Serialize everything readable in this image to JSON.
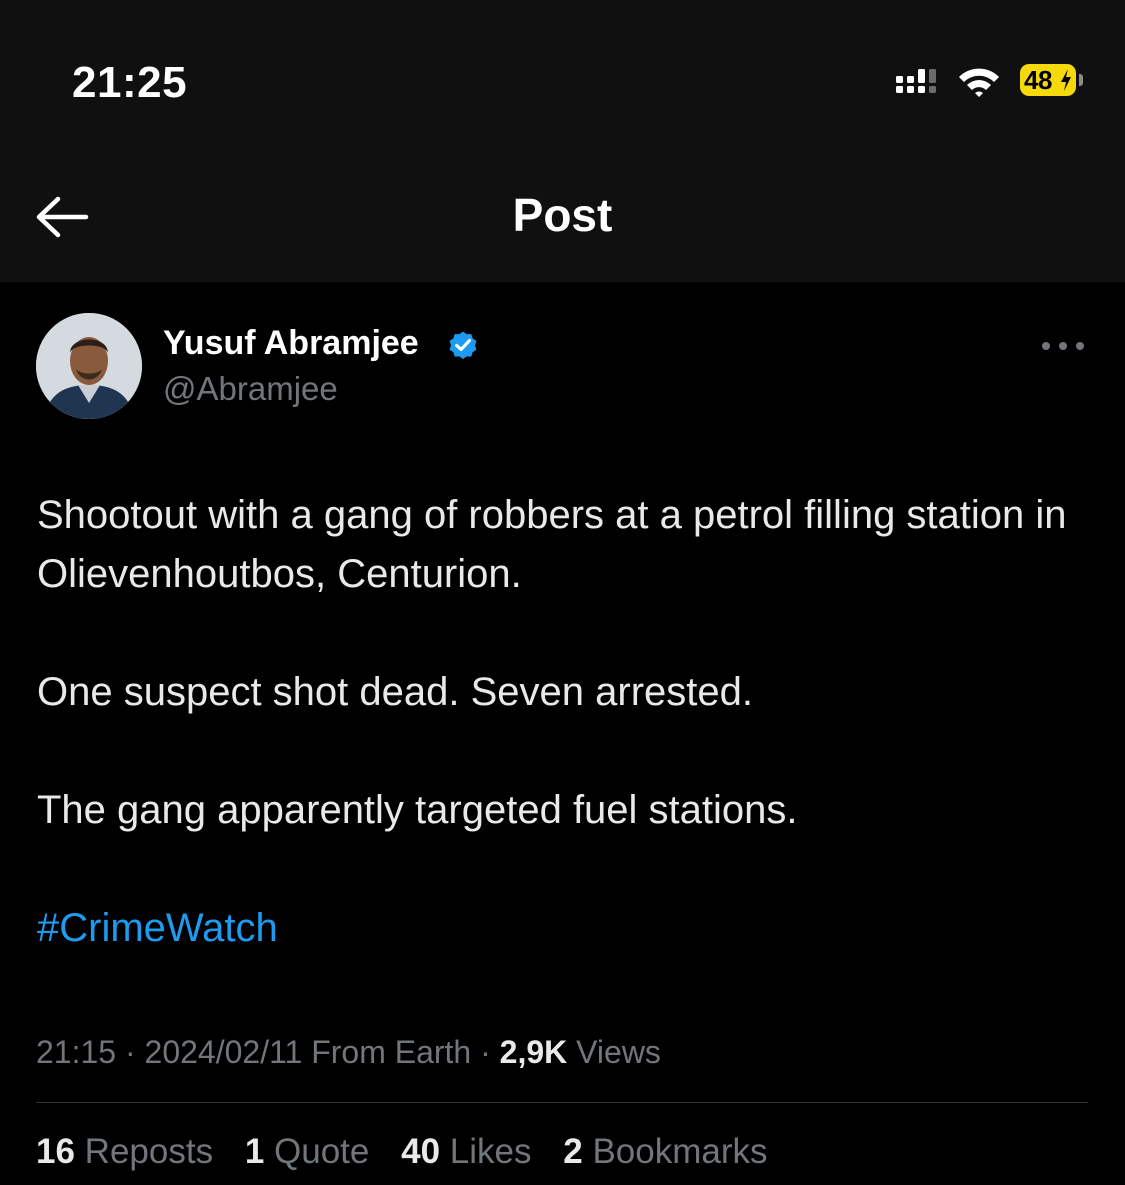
{
  "status_bar": {
    "time": "21:25",
    "battery": "48",
    "battery_color": "#f5d90a"
  },
  "header": {
    "title": "Post",
    "back_icon": "arrow-left-icon"
  },
  "author": {
    "name": "Yusuf Abramjee",
    "handle": "@Abramjee",
    "verified": true,
    "verified_color": "#1d9bf0"
  },
  "tweet": {
    "paragraphs": [
      "Shootout with a gang of robbers at a petrol filling station in Olievenhoutbos, Centurion.",
      "One suspect shot dead. Seven arrested.",
      "The gang apparently targeted fuel stations."
    ],
    "hashtag": "#CrimeWatch"
  },
  "meta": {
    "time": "21:15",
    "date": "2024/02/11",
    "source": "From Earth",
    "views_count": "2,9K",
    "views_label": "Views"
  },
  "stats": [
    {
      "count": "16",
      "label": "Reposts"
    },
    {
      "count": "1",
      "label": "Quote"
    },
    {
      "count": "40",
      "label": "Likes"
    },
    {
      "count": "2",
      "label": "Bookmarks"
    }
  ],
  "colors": {
    "accent": "#1d9bf0",
    "background": "#000000",
    "header_bg": "#101010",
    "secondary_text": "#71767b"
  }
}
